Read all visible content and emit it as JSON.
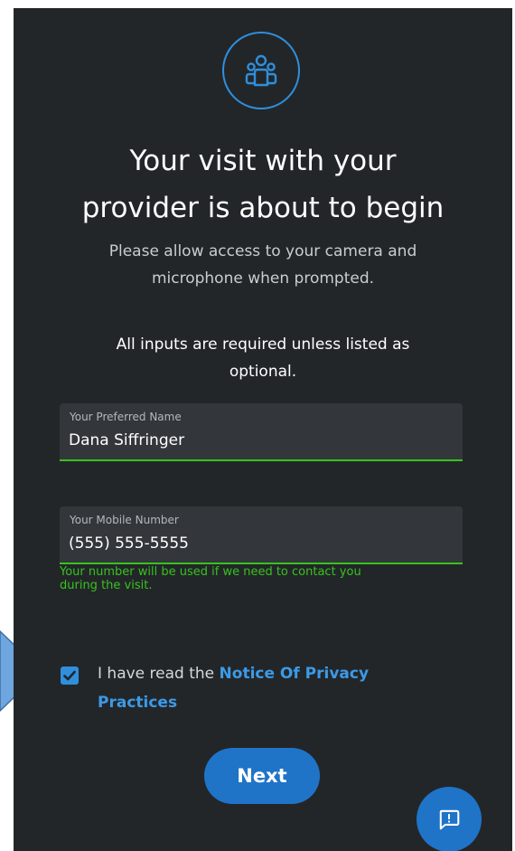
{
  "header": {
    "icon": "people-group-icon",
    "title_line1": "Your visit with your",
    "title_line2": "provider is about to begin",
    "subtitle_line1": "Please allow access to your camera and",
    "subtitle_line2": "microphone when prompted."
  },
  "form": {
    "required_note_line1": "All inputs are required unless listed as",
    "required_note_line2": "optional.",
    "preferred_name": {
      "label": "Your Preferred Name",
      "value": "Dana Siffringer"
    },
    "mobile_number": {
      "label": "Your Mobile Number",
      "value": "(555) 555-5555",
      "helper_line1": "Your number will be used if we need to contact you",
      "helper_line2": "during the visit."
    },
    "privacy": {
      "checked": true,
      "text": "I have read the",
      "link_line1": "Notice Of Privacy",
      "link_line2": "Practices"
    },
    "next_label": "Next"
  },
  "colors": {
    "background": "#232629",
    "accent": "#1f74c8",
    "link": "#3c9ae6",
    "valid": "#35c41d",
    "annotation_arrow": "#6fa6e0"
  },
  "fab": {
    "icon": "feedback-icon"
  },
  "annotation": {
    "icon": "arrow-pointer-icon"
  }
}
